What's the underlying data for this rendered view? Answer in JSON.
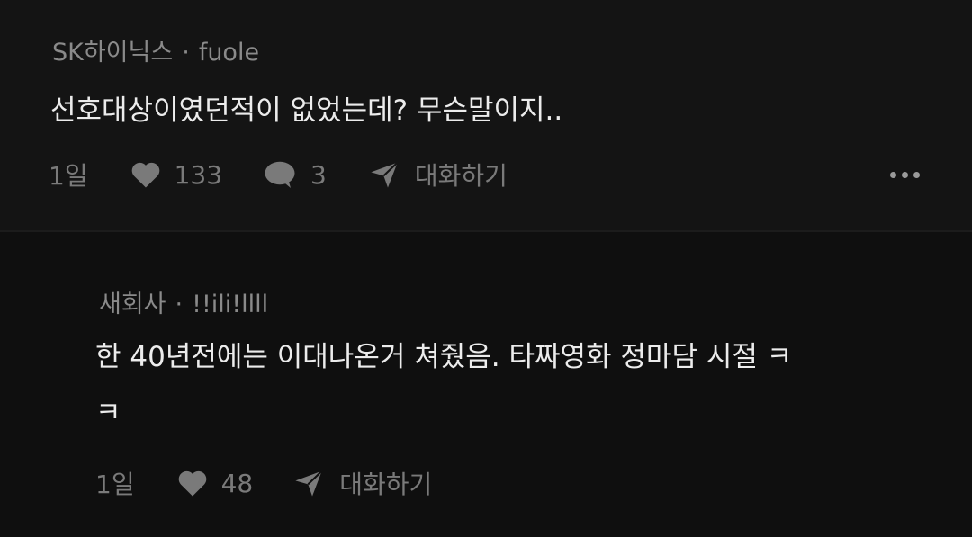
{
  "comment": {
    "company": "SK하이닉스",
    "separator": "·",
    "author": "fuole",
    "text": "선호대상이였던적이 없었는데? 무슨말이지..",
    "time": "1일",
    "likes": "133",
    "replies": "3",
    "chat_label": "대화하기",
    "icons": {
      "like": "heart-icon",
      "reply": "speech-bubble-icon",
      "chat": "paper-plane-icon",
      "more": "more-dots-icon"
    }
  },
  "reply": {
    "company": "새회사",
    "separator": "·",
    "author": "!!ili!llll",
    "text_line1": "한 40년전에는 이대나온거 쳐줬음. 타짜영화 정마담 시절 ㅋ",
    "text_line2": "ㅋ",
    "time": "1일",
    "likes": "48",
    "chat_label": "대화하기"
  },
  "colors": {
    "background": "#121212",
    "primary_text": "#ececec",
    "secondary_text": "#8a8a8a"
  }
}
